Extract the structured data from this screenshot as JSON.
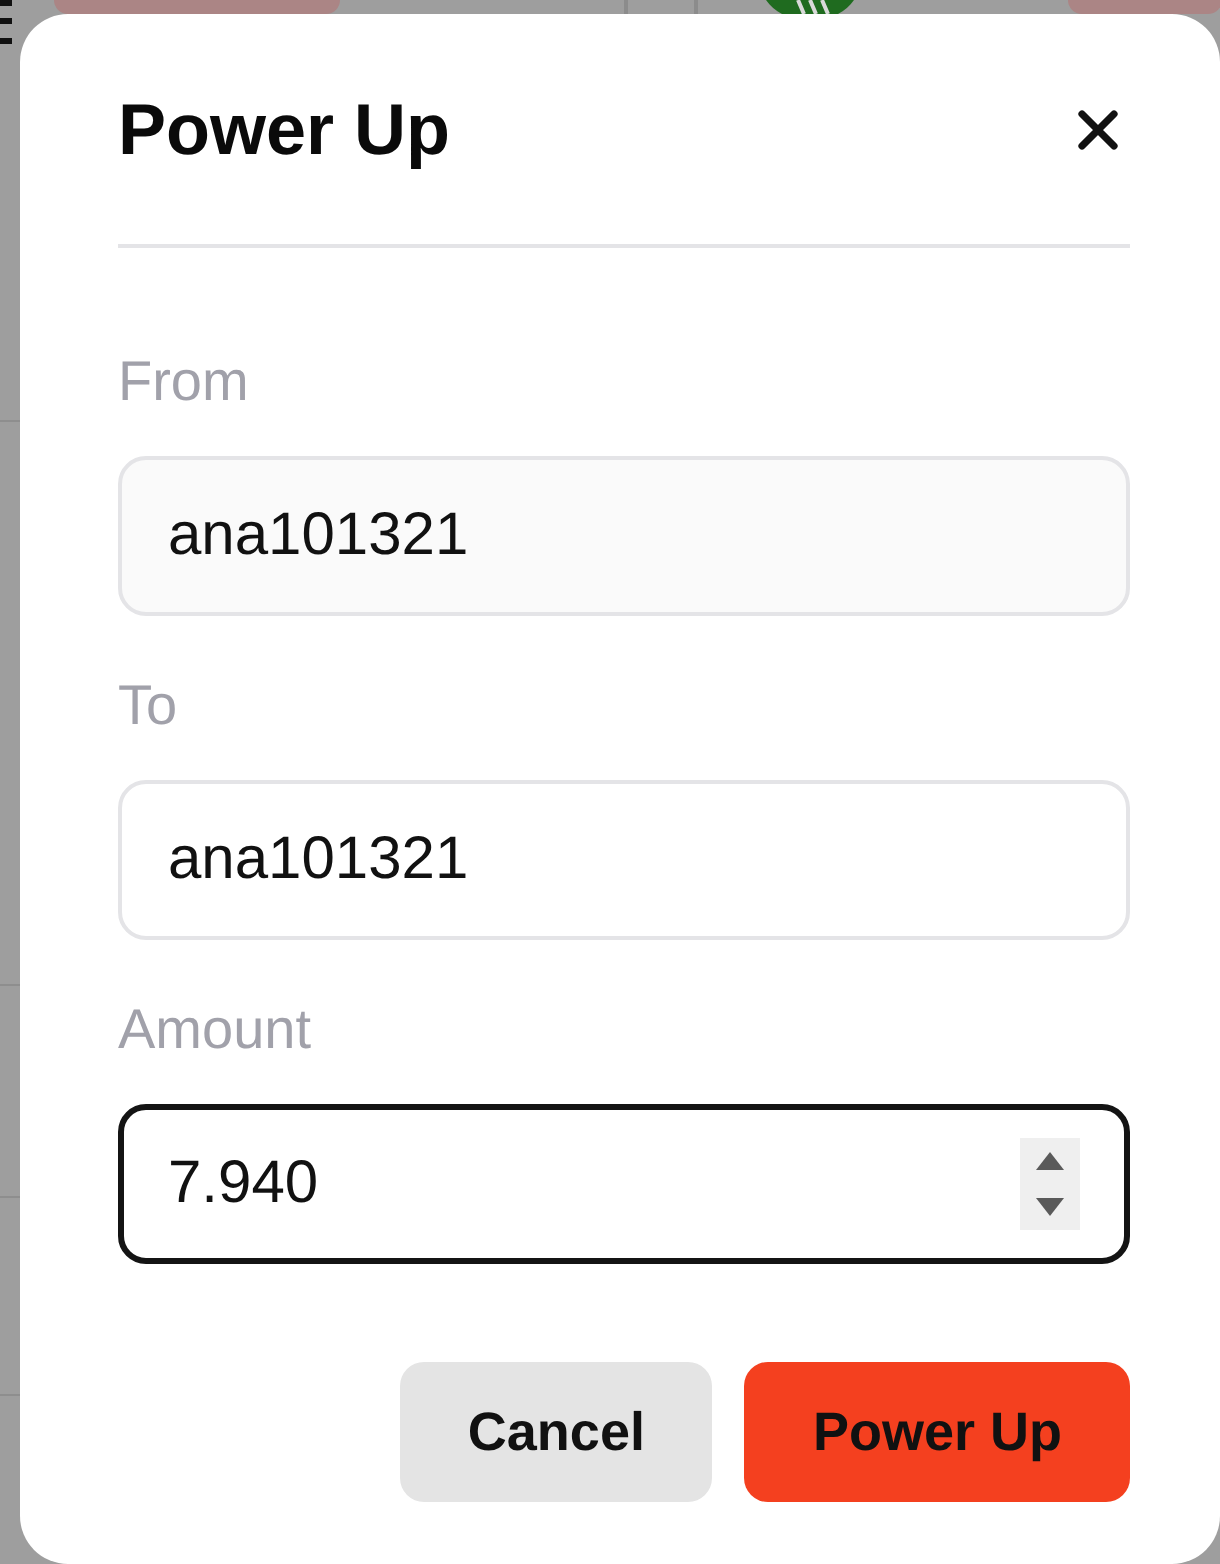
{
  "dialog": {
    "title": "Power Up"
  },
  "fields": [
    {
      "kind": "readonly",
      "label": "From",
      "value": "ana101321",
      "focused": false
    },
    {
      "kind": "text",
      "label": "To",
      "value": "ana101321",
      "focused": false
    },
    {
      "kind": "number",
      "label": "Amount",
      "value": "7.940",
      "focused": true
    }
  ],
  "buttons": [
    {
      "kind": "secondary",
      "label": "Cancel"
    },
    {
      "kind": "primary",
      "label": "Power Up"
    }
  ]
}
